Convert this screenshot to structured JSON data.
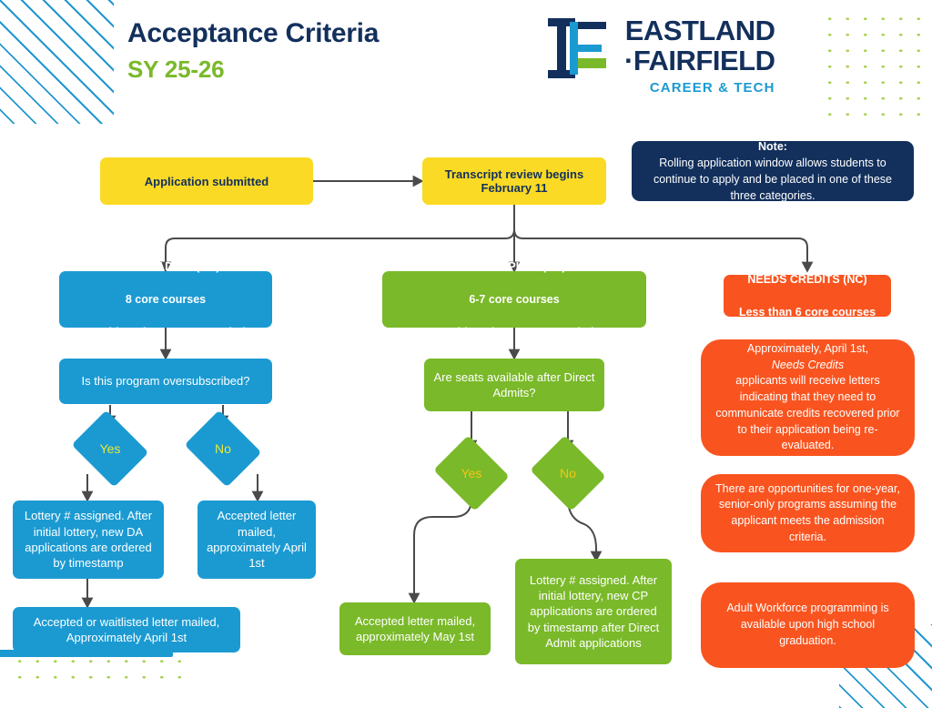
{
  "header": {
    "title": "Acceptance Criteria",
    "subtitle": "SY 25-26",
    "logo": {
      "line1": "EASTLAND",
      "line2": "·FAIRFIELD",
      "line3": "CAREER & TECH",
      "mark_name": "ef-monogram-logo"
    }
  },
  "colors": {
    "navy": "#13305c",
    "green": "#7ab929",
    "blue": "#1b9ad2",
    "orange": "#f9541f",
    "yellow": "#fada24",
    "dot_green": "#a7d353",
    "diamond_label_blue": "#e8e83a",
    "diamond_label_green": "#f5c518",
    "connector": "#4a4a4a"
  },
  "note": {
    "label": "Note:",
    "text": " Rolling application window allows students to continue to apply and be placed in one of these three categories."
  },
  "flow": {
    "application_submitted": "Application submitted",
    "transcript_review": "Transcript review begins February 11",
    "branches": [
      {
        "key": "direct-admit",
        "heading": "DIRECT ADMIT (DA)",
        "subheading": "8 core courses",
        "note_italic": "Health and PE recommended",
        "question": "Is this program oversubscribed?",
        "yes_label": "Yes",
        "no_label": "No",
        "yes_outcome": "Lottery # assigned. After initial lottery, new DA applications are ordered by timestamp",
        "yes_followup": "Accepted or waitlisted letter mailed, Approximately April 1st",
        "no_outcome": "Accepted letter mailed, approximately April 1st"
      },
      {
        "key": "credit-plan",
        "heading": "CREDIT PLAN (CP)",
        "subheading": "6-7 core courses",
        "note_italic": "Health and PE recommended",
        "question": "Are seats available after Direct Admits?",
        "yes_label": "Yes",
        "no_label": "No",
        "yes_outcome": "Accepted letter mailed, approximately May 1st",
        "no_outcome": "Lottery # assigned. After initial lottery, new CP applications are ordered by timestamp after Direct Admit applications"
      },
      {
        "key": "needs-credits",
        "heading": "NEEDS CREDITS (NC)",
        "subheading": "Less than 6 core courses"
      }
    ]
  },
  "info_cards": [
    {
      "key": "needs-credits-letters",
      "pre": "Approximately, April 1st, ",
      "italic": "Needs Credits",
      "post": " applicants will receive letters indicating that they need to communicate credits recovered prior to their application being re-evaluated."
    },
    {
      "key": "senior-only-programs",
      "text": "There are opportunities for one-year, senior-only programs assuming the applicant meets the admission criteria."
    },
    {
      "key": "adult-workforce",
      "text": "Adult Workforce programming is available upon high school graduation."
    }
  ]
}
